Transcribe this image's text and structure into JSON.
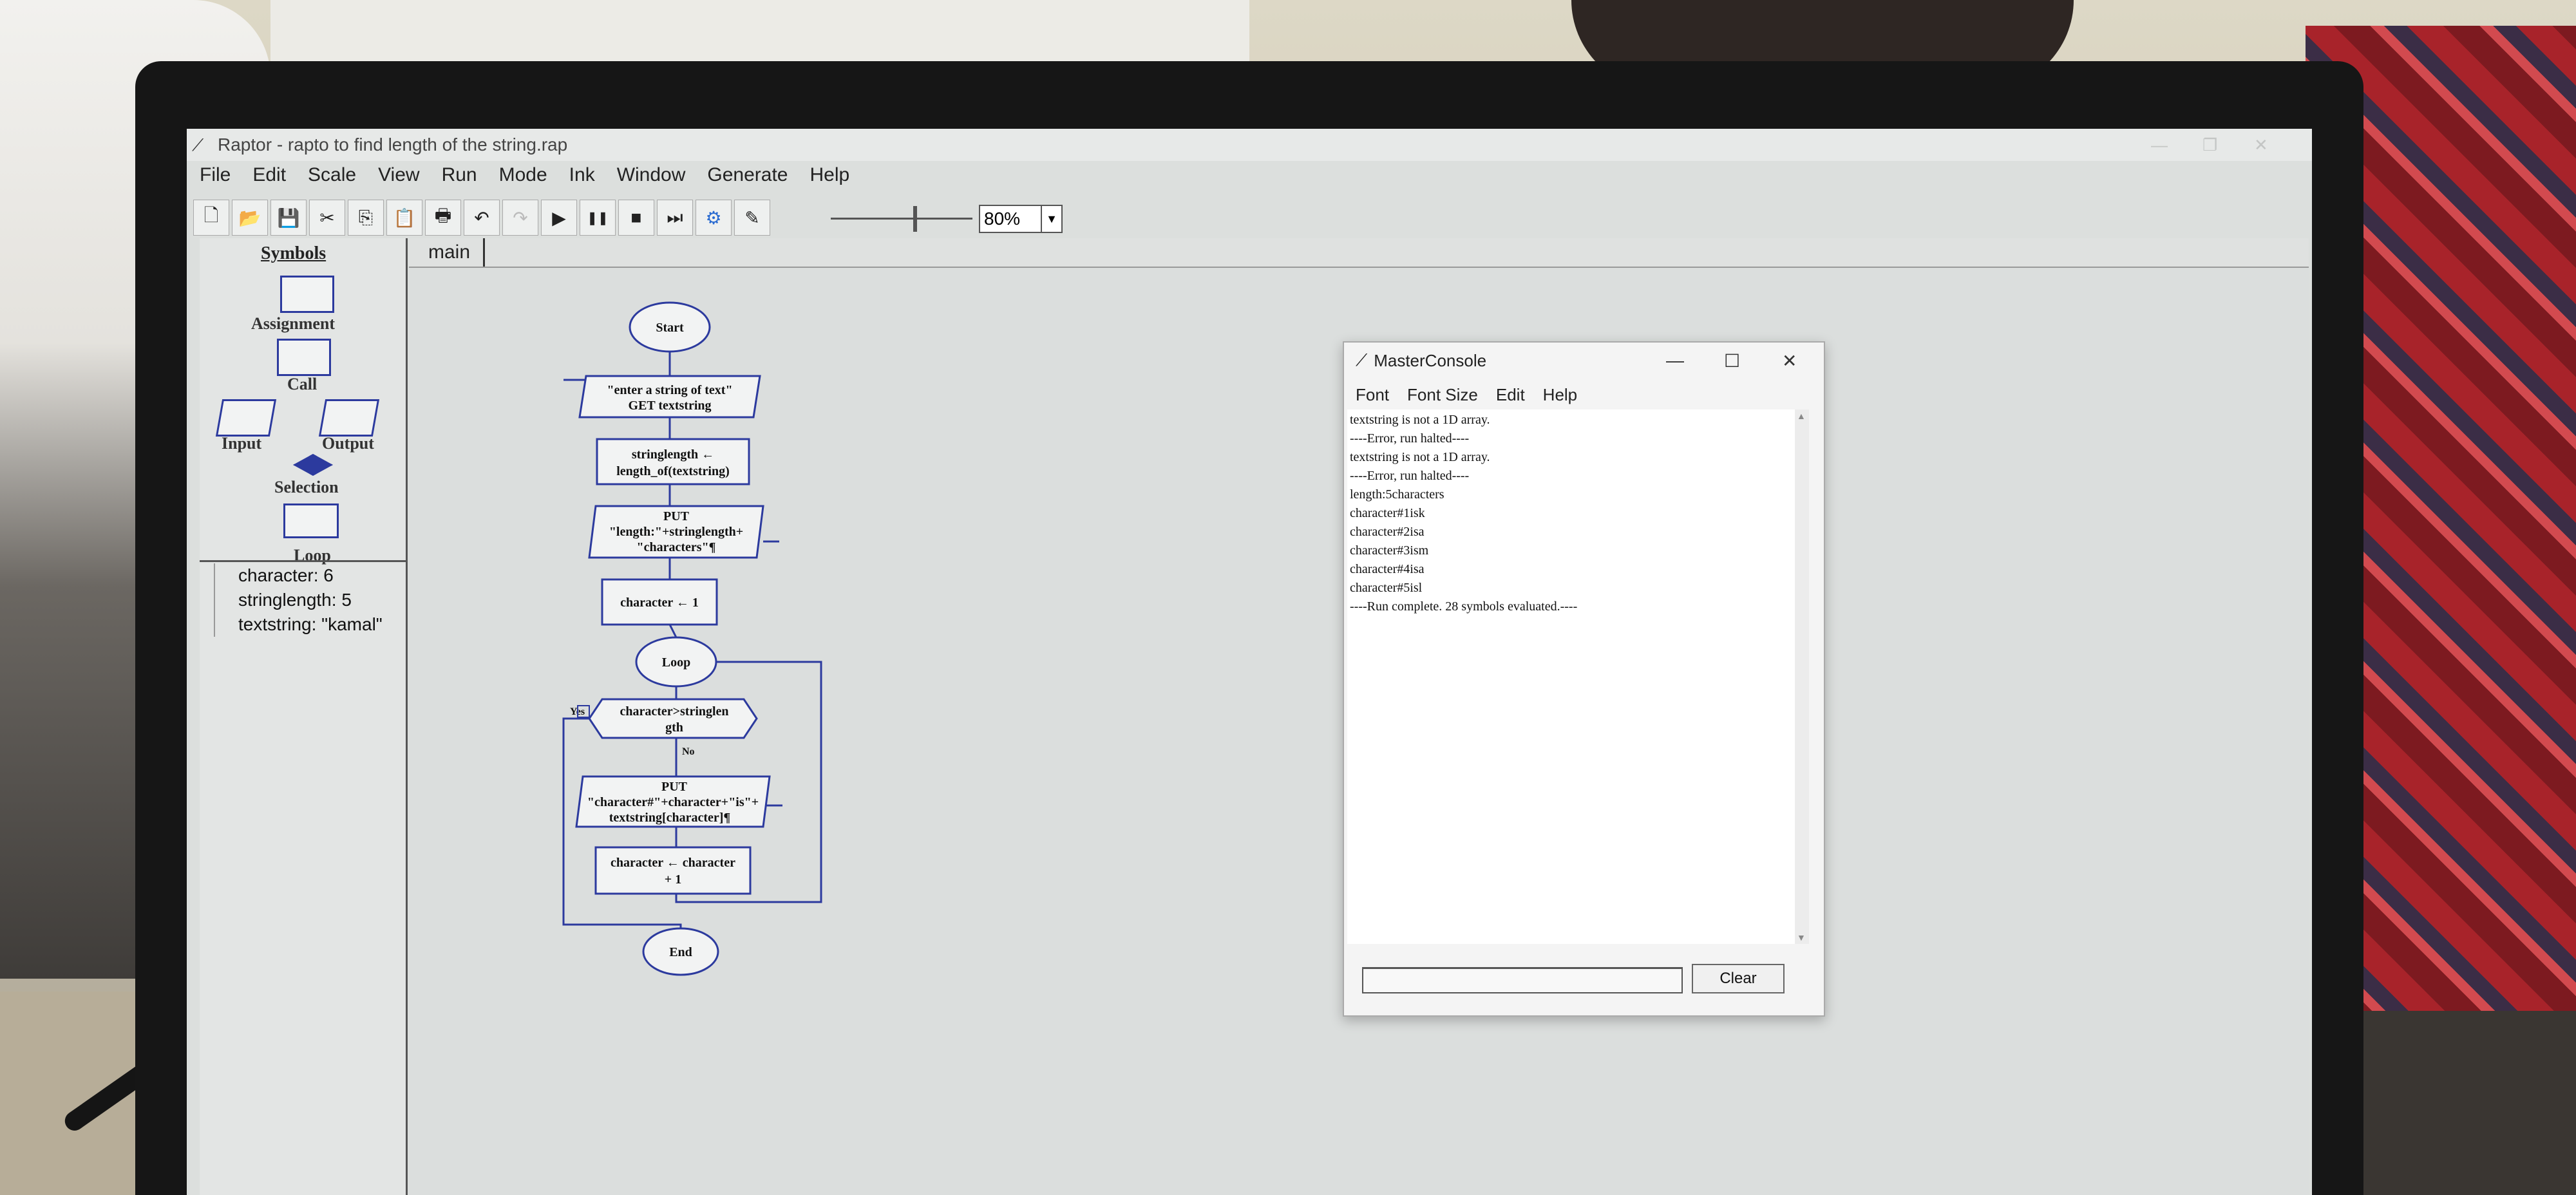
{
  "window": {
    "title": "Raptor - rapto to find length of the string.rap",
    "app_icon": "raptor-bird-icon"
  },
  "menu": [
    "File",
    "Edit",
    "Scale",
    "View",
    "Run",
    "Mode",
    "Ink",
    "Window",
    "Generate",
    "Help"
  ],
  "toolbar": {
    "buttons": [
      {
        "name": "new",
        "glyph": "🗋"
      },
      {
        "name": "open",
        "glyph": "📂"
      },
      {
        "name": "save",
        "glyph": "💾"
      },
      {
        "name": "cut",
        "glyph": "✂"
      },
      {
        "name": "copy",
        "glyph": "⎘"
      },
      {
        "name": "paste",
        "glyph": "📋"
      },
      {
        "name": "print",
        "glyph": "🖶"
      },
      {
        "name": "undo",
        "glyph": "↶"
      },
      {
        "name": "redo",
        "glyph": "↷"
      },
      {
        "name": "play",
        "glyph": "▶"
      },
      {
        "name": "pause",
        "glyph": "❚❚"
      },
      {
        "name": "stop",
        "glyph": "■"
      },
      {
        "name": "step",
        "glyph": "⏭"
      },
      {
        "name": "test",
        "glyph": "⚙"
      },
      {
        "name": "pen",
        "glyph": "✎"
      }
    ],
    "speed_level": 0.6,
    "zoom": "80%"
  },
  "symbols": {
    "heading": "Symbols",
    "items": [
      "Assignment",
      "Call",
      "Input",
      "Output",
      "Selection",
      "Loop"
    ]
  },
  "variables": [
    "character: 6",
    "stringlength: 5",
    "textstring: \"kamal\""
  ],
  "tabs": [
    "main"
  ],
  "flowchart": {
    "start": "Start",
    "input_l1": "\"enter a string of text\"",
    "input_l2": "GET textstring",
    "assign1_l1": "stringlength ←",
    "assign1_l2": "length_of(textstring)",
    "output1_l1": "PUT",
    "output1_l2": "\"length:\"+stringlength+",
    "output1_l3": "\"characters\"¶",
    "assign2": "character ← 1",
    "loop": "Loop",
    "cond_l1": "character>stringlen",
    "cond_l2": "gth",
    "yes": "Yes",
    "no": "No",
    "output2_l1": "PUT",
    "output2_l2": "\"character#\"+character+\"is\"+",
    "output2_l3": "textstring[character]¶",
    "assign3_l1": "character ← character",
    "assign3_l2": "+ 1",
    "end": "End"
  },
  "console": {
    "title": "MasterConsole",
    "menu": [
      "Font",
      "Font Size",
      "Edit",
      "Help"
    ],
    "lines": [
      "textstring is not a 1D array.",
      "----Error, run halted----",
      "textstring is not a 1D array.",
      "----Error, run halted----",
      "length:5characters",
      "character#1isk",
      "character#2isa",
      "character#3ism",
      "character#4isa",
      "character#5isl",
      "----Run complete.  28 symbols evaluated.----"
    ],
    "input_value": "",
    "clear_label": "Clear"
  }
}
